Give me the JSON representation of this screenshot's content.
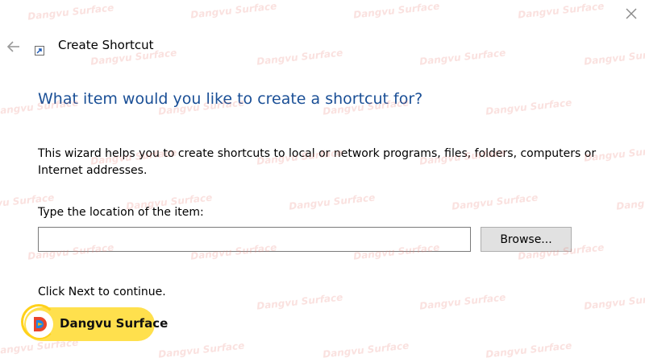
{
  "window": {
    "title": "Create Shortcut",
    "close_icon": "close-icon",
    "back_icon": "back-arrow-icon",
    "title_icon": "shortcut-icon"
  },
  "main": {
    "heading": "What item would you like to create a shortcut for?",
    "description": "This wizard helps you to create shortcuts to local or network programs, files, folders, computers or Internet addresses.",
    "location_label": "Type the location of the item:",
    "location_value": "",
    "location_placeholder": "",
    "browse_label": "Browse...",
    "continue_text": "Click Next to continue."
  },
  "branding": {
    "watermark_text": "Dangvu Surface",
    "logo_text": "Dangvu Surface",
    "logo_icon": "dangvu-logo-icon",
    "logo_colors": [
      "#ffe04d",
      "#e8452c",
      "#1e88e5",
      "#ffb300"
    ]
  },
  "colors": {
    "heading": "#1a4f96",
    "button_bg": "#e1e1e1",
    "input_border": "#7a7a7a"
  }
}
